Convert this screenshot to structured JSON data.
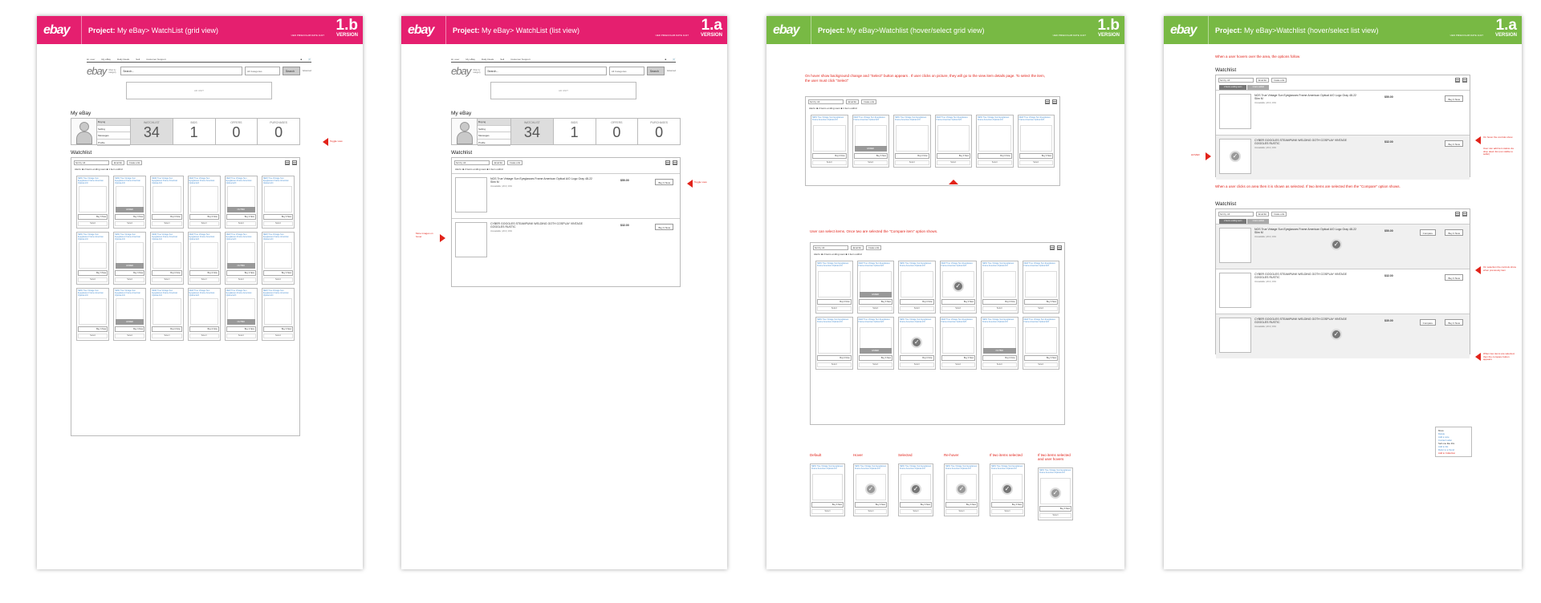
{
  "sheets": [
    {
      "title_prefix": "Project:",
      "title": "My eBay> WatchList (grid view)",
      "version": "1.b",
      "version_label": "VERSION"
    },
    {
      "title_prefix": "Project:",
      "title": "My eBay> WatchList (list view)",
      "version": "1.a",
      "version_label": "VERSION"
    },
    {
      "title_prefix": "Project:",
      "title": "My eBay>Watchlist (hover/select grid view)",
      "version": "1.b",
      "version_label": "VERSION"
    },
    {
      "title_prefix": "Project:",
      "title": "My eBay>Watchlist (hover/select list view)",
      "version": "1.a",
      "version_label": "VERSION"
    }
  ],
  "brand": "ebay",
  "meta_line": "UED  PM/ECOLAB  DATE 11/27",
  "nav": {
    "items": [
      "Hi, user",
      "My eBay",
      "Daily Deals",
      "Sell",
      "Customer Support"
    ]
  },
  "search": {
    "logo": "ebay",
    "shop_by": "Shop by category",
    "placeholder": "Search...",
    "category": "All Categories",
    "button": "Search",
    "advanced": "Advanced"
  },
  "ad_label": "AD UNIT",
  "my_ebay": {
    "heading": "My eBay",
    "menu": [
      "Buying",
      "Selling",
      "Messages",
      "Profile"
    ],
    "counters": [
      {
        "label": "WATCHLIST",
        "value": "34"
      },
      {
        "label": "BIDS",
        "value": "1"
      },
      {
        "label": "OFFERS",
        "value": "0"
      },
      {
        "label": "PURCHASES",
        "value": "0"
      }
    ]
  },
  "watchlist": {
    "heading": "Watchlist",
    "sort": "Sort by: All",
    "btn_email": "Email list",
    "btn_create": "Create a list",
    "alerts_label": "Alerts:",
    "alert1": "2 items ending soon",
    "alert2": "1 item outbid",
    "card_title": "NEW True Vintage Sun Eyeglasses Frame American Optical A/O",
    "buy_label": "Buy It Now",
    "select_label": "Select",
    "ended": "ENDED",
    "outbid": "OUTBID",
    "compare": "Compare"
  },
  "list_items": [
    {
      "title": "NOS True Vintage Sun Eyeglasses Frame American Optical A/O Logo Gray 48-22 Slim M",
      "sub": "Unavailable | 20.0 | 19%",
      "price": "$50.00",
      "shipping": "Free Shipping",
      "button": "Buy It Now"
    },
    {
      "title": "CYBER GOGGLES STEAMPUNK WELDING GOTH COSPLAY VINTAGE GOGGLES RUSTIC",
      "sub": "Unavailable | 20.0 | 19%",
      "price": "$32.00",
      "shipping": "Free Shipping",
      "button": "Buy It Now"
    },
    {
      "title": "CYBER GOGGLES STEAMPUNK WELDING GOTH COSPLAY VINTAGE GOGGLES RUSTIC",
      "sub": "Unavailable | 20.0 | 19%",
      "price": "$30.00",
      "shipping": "Free Shipping",
      "button": "Buy It Now"
    }
  ],
  "annotations": {
    "toggle_view": "Toggle view",
    "more_images": "More images on hover",
    "grid_hover_note": "On hover show background change and \"Select\" button appears . If user clicks on picture, they will go to the view item details page. To select the item, the user must click \"Select\"",
    "grid_select_note": "User can select items. Once two are selected the \"Compare item\" option shows.",
    "list_hover_note": "When a user hovers over the area, the options follow",
    "list_select_note": "When a user clicks on area then it is shown as selected. If two items are selected then the \"Compare\" option shows.",
    "hover_label": "HOVER",
    "on_hover": "On hover the controls show",
    "user_can": "User can add item status via drop down list (not visible to seller)",
    "on_selection": "On selection the controls show when previously item",
    "two_selected": "When two items are selected, then the compare button appears"
  },
  "states": [
    "Default",
    "Hover",
    "Selected",
    "Re-hover",
    "If two items selected",
    "If two items selected and user hovers"
  ],
  "tabs": [
    "2 items ending soon",
    "1 item outbid"
  ],
  "dropdown_menu": {
    "items": [
      "Move",
      "Delete",
      "Add a note",
      "Contact seller",
      "Sell one like this",
      "Add to list",
      "Refer to a friend",
      "Add to Collection"
    ]
  }
}
